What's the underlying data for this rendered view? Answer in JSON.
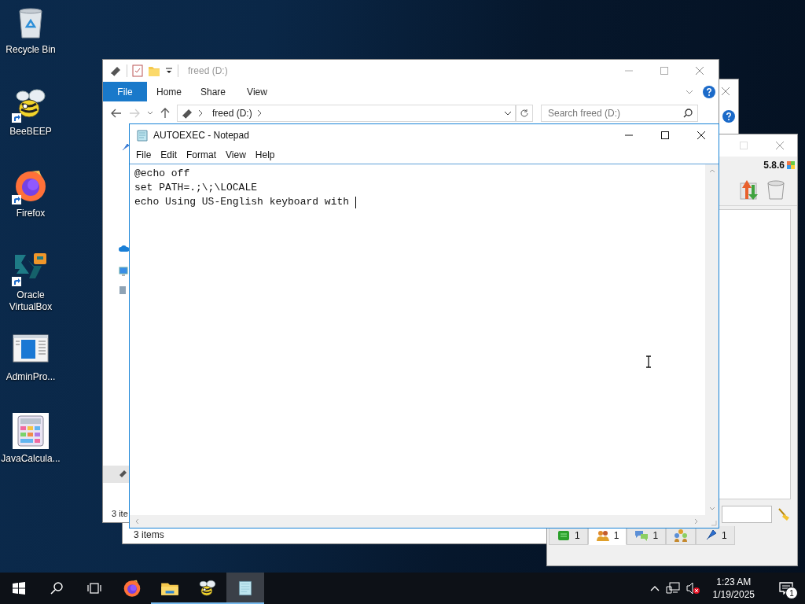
{
  "desktop_icons": [
    {
      "kind": "recycle-bin",
      "label": "Recycle Bin",
      "shortcut": false
    },
    {
      "kind": "bee",
      "label": "BeeBEEP",
      "shortcut": true
    },
    {
      "kind": "firefox",
      "label": "Firefox",
      "shortcut": true
    },
    {
      "kind": "virtualbox",
      "label": "Oracle VirtualBox",
      "shortcut": true
    },
    {
      "kind": "admin-window",
      "label": "AdminPro...",
      "shortcut": false
    },
    {
      "kind": "calculator",
      "label": "JavaCalcula...",
      "shortcut": false
    }
  ],
  "back_explorer": {
    "status_bar": "3 items"
  },
  "explorer": {
    "title": "freed (D:)",
    "ribbon_tabs": [
      {
        "label": "File",
        "selected": true
      },
      {
        "label": "Home",
        "selected": false
      },
      {
        "label": "Share",
        "selected": false
      },
      {
        "label": "View",
        "selected": false
      }
    ],
    "address": "freed (D:)",
    "search": {
      "placeholder": "Search freed (D:)"
    },
    "status_bar": "3 ite"
  },
  "beebeep": {
    "version": "5.8.6",
    "tabs": [
      {
        "kind": "chat-list",
        "count": "1",
        "selected": false
      },
      {
        "kind": "users",
        "count": "1",
        "selected": true
      },
      {
        "kind": "chats",
        "count": "1",
        "selected": false
      },
      {
        "kind": "groups",
        "selected": false
      },
      {
        "kind": "pin",
        "count": "1",
        "selected": false
      }
    ]
  },
  "notepad": {
    "title": "AUTOEXEC - Notepad",
    "menu": [
      "File",
      "Edit",
      "Format",
      "View",
      "Help"
    ],
    "lines": [
      "@echo off",
      "set PATH=.;\\;\\LOCALE",
      "echo Using US-English keyboard with "
    ]
  },
  "taskbar": {
    "apps": [
      {
        "kind": "firefox",
        "running": false,
        "selected": false
      },
      {
        "kind": "file-explorer",
        "running": true,
        "selected": false
      },
      {
        "kind": "bee",
        "running": true,
        "selected": false
      },
      {
        "kind": "notepad",
        "running": true,
        "selected": true
      }
    ],
    "time": "1:23 AM",
    "date": "1/19/2025",
    "notifications": "1"
  }
}
